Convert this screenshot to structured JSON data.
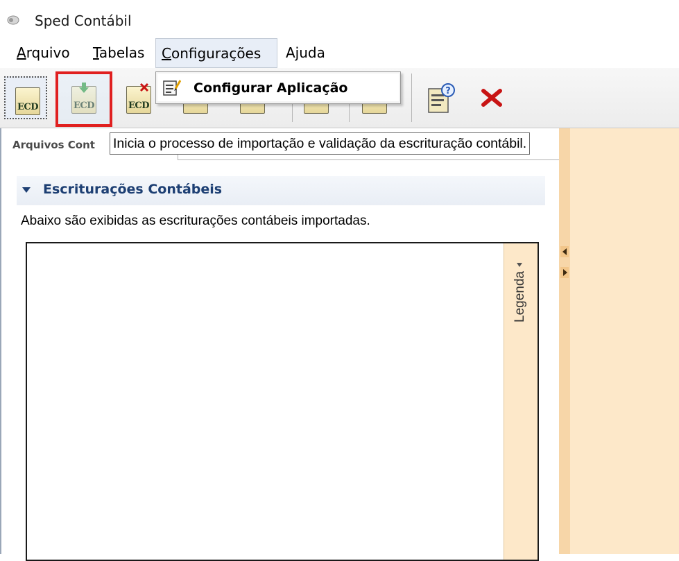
{
  "window": {
    "title": "Sped Contábil"
  },
  "menu": {
    "items": [
      {
        "label": "Arquivo"
      },
      {
        "label": "Tabelas"
      },
      {
        "label": "Configurações"
      },
      {
        "label": "Ajuda"
      }
    ],
    "open_menu": "Configurações",
    "dropdown": {
      "items": [
        {
          "label": "Configurar Aplicação"
        }
      ]
    }
  },
  "toolbar": {
    "ecd_label": "ECD",
    "highlighted_button": "import-ecd-button",
    "tooltip": "Inicia o processo de importação e validação da escrituração contábil."
  },
  "panel": {
    "tab_label": "Arquivos Cont",
    "section_title": "Escriturações Contábeis",
    "section_description": "Abaixo são exibidas as escriturações contábeis importadas.",
    "legend_label": "Legenda"
  },
  "colors": {
    "highlight": "#e02020",
    "section_title": "#1d3f73",
    "side_panel": "#fde8c9",
    "close_icon": "#c81414"
  }
}
